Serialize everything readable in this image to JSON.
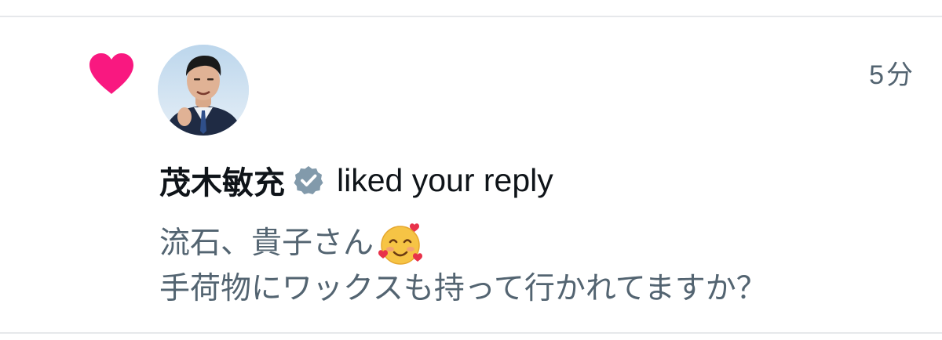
{
  "notification": {
    "timestamp": "5分",
    "user_name": "茂木敏充",
    "action": "liked your reply",
    "reply_line_1": "流石、貴子さん",
    "reply_line_2": "手荷物にワックスも持って行かれてますか？",
    "icons": {
      "like": "heart-icon",
      "verified": "verified-badge-icon",
      "emoji": "smiling-face-with-hearts-icon",
      "avatar": "user-avatar"
    },
    "colors": {
      "like": "#f91880",
      "name": "#0f1419",
      "secondary_text": "#536471",
      "verified_badge": "#829aab",
      "divider": "#e6e8eb"
    }
  }
}
